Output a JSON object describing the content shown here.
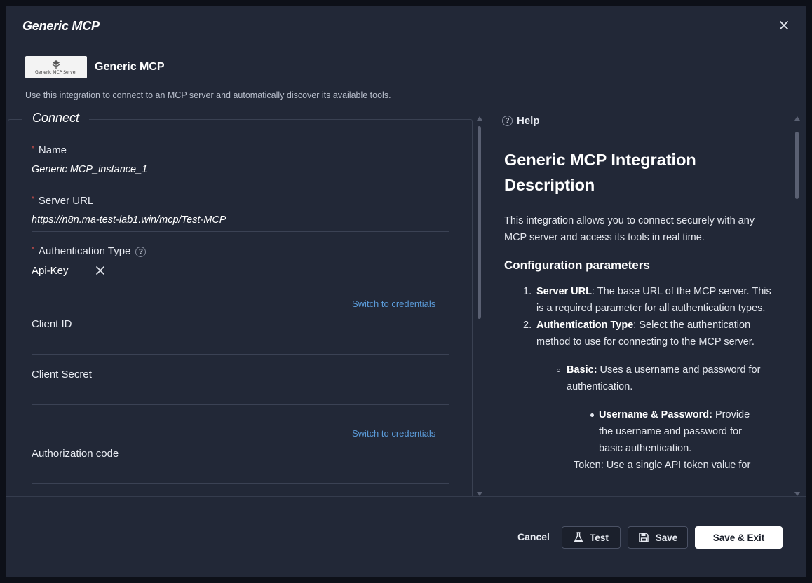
{
  "modal": {
    "title": "Generic MCP",
    "integration_name": "Generic MCP",
    "logo_text": "Generic MCP Server",
    "description": "Use this integration to connect to an MCP server and automatically discover its available tools."
  },
  "connect": {
    "legend": "Connect",
    "name_label": "Name",
    "name_value": "Generic MCP_instance_1",
    "server_url_label": "Server URL",
    "server_url_value": "https://n8n.ma-test-lab1.win/mcp/Test-MCP",
    "auth_type_label": "Authentication Type",
    "auth_type_value": "Api-Key",
    "switch_link_1": "Switch to credentials",
    "client_id_label": "Client ID",
    "client_secret_label": "Client Secret",
    "switch_link_2": "Switch to credentials",
    "auth_code_label": "Authorization code",
    "required_mark": "*",
    "help_mark": "?"
  },
  "help": {
    "header": "Help",
    "title": "Generic MCP Integration Description",
    "intro": "This integration allows you to connect securely with any MCP server and access its tools in real time.",
    "subtitle": "Configuration parameters",
    "items": [
      {
        "num": "1.",
        "term": "Server URL",
        "text": ": The base URL of the MCP server. This is a required parameter for all authentication types."
      },
      {
        "num": "2.",
        "term": "Authentication Type",
        "text": ": Select the authentication method to use for connecting to the MCP server."
      }
    ],
    "basic_term": "Basic:",
    "basic_text": " Uses a username and password for authentication.",
    "userpass_term": "Username & Password:",
    "userpass_text": " Provide the username and password for basic authentication.",
    "cut_text": "Token: Use a single API token value for"
  },
  "footer": {
    "cancel": "Cancel",
    "test": "Test",
    "save": "Save",
    "save_exit": "Save & Exit"
  },
  "colors": {
    "background": "#222837",
    "link": "#5b9bd9",
    "required": "#d9534f",
    "primary_button": "#ffffff"
  },
  "icons": [
    "close-icon",
    "help-icon",
    "clear-icon",
    "flask-icon",
    "floppy-disk-icon"
  ]
}
